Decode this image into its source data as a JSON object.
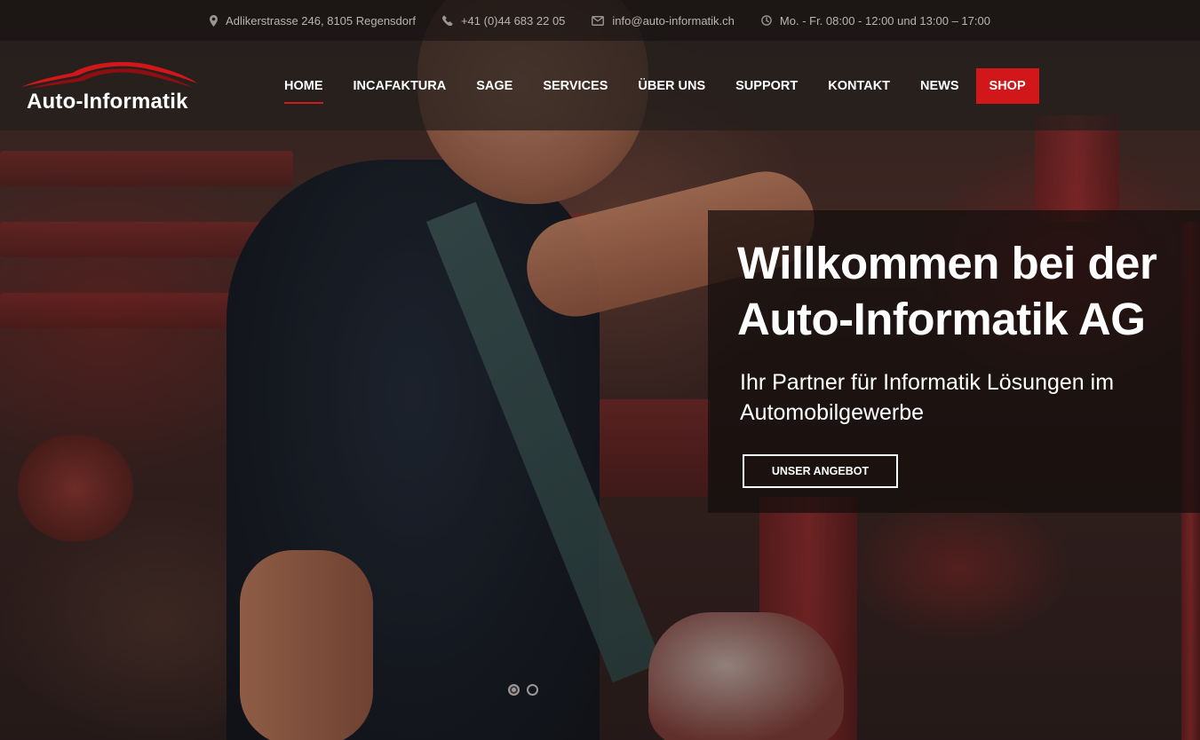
{
  "topbar": {
    "address": "Adlikerstrasse 246, 8105 Regensdorf",
    "address_icon": "map-marker-icon",
    "phone": "+41 (0)44 683 22 05",
    "phone_icon": "phone-icon",
    "email": "info@auto-informatik.ch",
    "email_icon": "envelope-icon",
    "hours": "Mo. - Fr. 08:00 - 12:00 und 13:00 – 17:00",
    "hours_icon": "clock-icon"
  },
  "header": {
    "logo_text": "Auto-Informatik",
    "nav": {
      "home": "HOME",
      "incafaktura": "INCAFAKTURA",
      "sage": "SAGE",
      "services": "SERVICES",
      "ueber_uns": "ÜBER UNS",
      "support": "SUPPORT",
      "kontakt": "KONTAKT",
      "news": "NEWS",
      "shop": "SHOP"
    },
    "active_item": "HOME"
  },
  "hero": {
    "title": "Willkommen bei der Auto-Informatik AG",
    "subtitle": "Ihr Partner für Informatik Lösungen im Automobilgewerbe",
    "button": "UNSER ANGEBOT",
    "slides_total": 2,
    "active_slide": 1
  },
  "colors": {
    "accent": "#d2171a",
    "topbar_bg": "#191614",
    "text_light": "#ffffff",
    "text_muted": "#b9b4b0"
  }
}
